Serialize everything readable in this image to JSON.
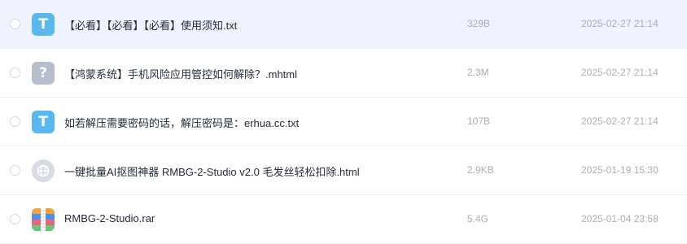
{
  "files": [
    {
      "name": "【必看】【必看】【必看】使用须知.txt",
      "size": "329B",
      "date": "2025-02-27 21:14",
      "type_icon": "text-file-icon",
      "icon_glyph": "T",
      "icon_color": "#5ab8ee",
      "highlighted": true
    },
    {
      "name": "【鸿蒙系统】手机风险应用管控如何解除？.mhtml",
      "size": "2.3M",
      "date": "2025-02-27 21:14",
      "type_icon": "unknown-file-icon",
      "icon_glyph": "?",
      "icon_color": "#b7bfcd",
      "highlighted": false
    },
    {
      "name": "如若解压需要密码的话，解压密码是：erhua.cc.txt",
      "size": "107B",
      "date": "2025-02-27 21:14",
      "type_icon": "text-file-icon",
      "icon_glyph": "T",
      "icon_color": "#5ab8ee",
      "highlighted": false
    },
    {
      "name": "一键批量AI抠图神器 RMBG-2-Studio v2.0 毛发丝轻松扣除.html",
      "size": "2.9KB",
      "date": "2025-01-19 15:30",
      "type_icon": "globe-file-icon",
      "icon_color": "#d6dbe4",
      "highlighted": false
    },
    {
      "name": "RMBG-2-Studio.rar",
      "size": "5.4G",
      "date": "2025-01-04 23:58",
      "type_icon": "archive-file-icon",
      "icon_colors": [
        "#f2a43a",
        "#4c8ff1",
        "#e8667a",
        "#6cc37a"
      ],
      "highlighted": false
    }
  ]
}
